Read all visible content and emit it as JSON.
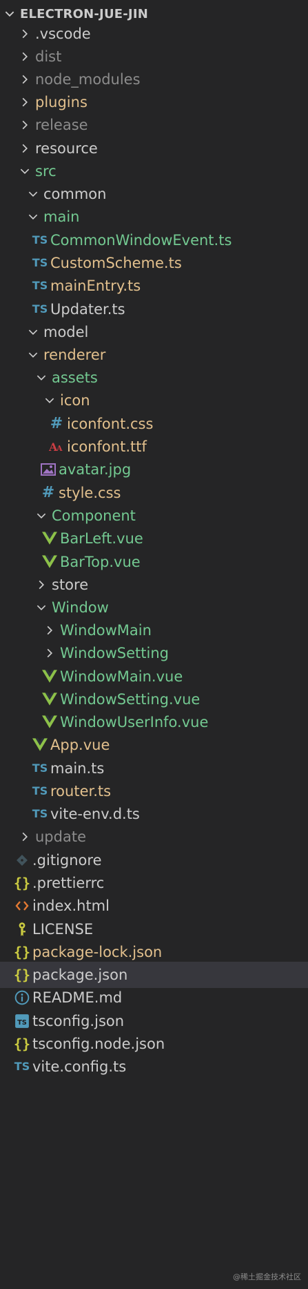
{
  "explorer": {
    "root_label": "ELECTRON-JUE-JIN",
    "items": [
      {
        "label": ".vscode",
        "color": "#cccccc",
        "icon": "chevron-right-icon"
      },
      {
        "label": "dist",
        "color": "#8c8c8c",
        "icon": "chevron-right-icon"
      },
      {
        "label": "node_modules",
        "color": "#8c8c8c",
        "icon": "chevron-right-icon"
      },
      {
        "label": "plugins",
        "color": "#e2c08d",
        "icon": "chevron-right-icon"
      },
      {
        "label": "release",
        "color": "#8c8c8c",
        "icon": "chevron-right-icon"
      },
      {
        "label": "resource",
        "color": "#cccccc",
        "icon": "chevron-right-icon"
      },
      {
        "label": "src",
        "color": "#73c991",
        "icon": "chevron-down-icon"
      },
      {
        "label": "common",
        "color": "#cccccc",
        "icon": "chevron-down-icon"
      },
      {
        "label": "main",
        "color": "#73c991",
        "icon": "chevron-down-icon"
      },
      {
        "label": "CommonWindowEvent.ts",
        "color": "#73c991",
        "icon": "typescript-icon",
        "icon_text": "TS"
      },
      {
        "label": "CustomScheme.ts",
        "color": "#e2c08d",
        "icon": "typescript-icon",
        "icon_text": "TS"
      },
      {
        "label": "mainEntry.ts",
        "color": "#e2c08d",
        "icon": "typescript-icon",
        "icon_text": "TS"
      },
      {
        "label": "Updater.ts",
        "color": "#cccccc",
        "icon": "typescript-icon",
        "icon_text": "TS"
      },
      {
        "label": "model",
        "color": "#cccccc",
        "icon": "chevron-down-icon"
      },
      {
        "label": "renderer",
        "color": "#e2c08d",
        "icon": "chevron-down-icon"
      },
      {
        "label": "assets",
        "color": "#73c991",
        "icon": "chevron-down-icon"
      },
      {
        "label": "icon",
        "color": "#e2c08d",
        "icon": "chevron-down-icon"
      },
      {
        "label": "iconfont.css",
        "color": "#e2c08d",
        "icon": "css-icon",
        "icon_text": "#"
      },
      {
        "label": "iconfont.ttf",
        "color": "#e2c08d",
        "icon": "font-file-icon",
        "icon_text": "A"
      },
      {
        "label": "avatar.jpg",
        "color": "#73c991",
        "icon": "image-icon"
      },
      {
        "label": "style.css",
        "color": "#e2c08d",
        "icon": "css-icon",
        "icon_text": "#"
      },
      {
        "label": "Component",
        "color": "#73c991",
        "icon": "chevron-down-icon"
      },
      {
        "label": "BarLeft.vue",
        "color": "#73c991",
        "icon": "vue-icon"
      },
      {
        "label": "BarTop.vue",
        "color": "#73c991",
        "icon": "vue-icon"
      },
      {
        "label": "store",
        "color": "#cccccc",
        "icon": "chevron-right-icon"
      },
      {
        "label": "Window",
        "color": "#73c991",
        "icon": "chevron-down-icon"
      },
      {
        "label": "WindowMain",
        "color": "#73c991",
        "icon": "chevron-right-icon"
      },
      {
        "label": "WindowSetting",
        "color": "#73c991",
        "icon": "chevron-right-icon"
      },
      {
        "label": "WindowMain.vue",
        "color": "#73c991",
        "icon": "vue-icon"
      },
      {
        "label": "WindowSetting.vue",
        "color": "#73c991",
        "icon": "vue-icon"
      },
      {
        "label": "WindowUserInfo.vue",
        "color": "#73c991",
        "icon": "vue-icon"
      },
      {
        "label": "App.vue",
        "color": "#e2c08d",
        "icon": "vue-icon"
      },
      {
        "label": "main.ts",
        "color": "#cccccc",
        "icon": "typescript-icon",
        "icon_text": "TS"
      },
      {
        "label": "router.ts",
        "color": "#e2c08d",
        "icon": "typescript-icon",
        "icon_text": "TS"
      },
      {
        "label": "vite-env.d.ts",
        "color": "#cccccc",
        "icon": "typescript-icon",
        "icon_text": "TS"
      },
      {
        "label": "update",
        "color": "#8c8c8c",
        "icon": "chevron-right-icon"
      },
      {
        "label": ".gitignore",
        "color": "#cccccc",
        "icon": "git-icon"
      },
      {
        "label": ".prettierrc",
        "color": "#cccccc",
        "icon": "json-braces-icon",
        "icon_text": "{}"
      },
      {
        "label": "index.html",
        "color": "#cccccc",
        "icon": "html-icon"
      },
      {
        "label": "LICENSE",
        "color": "#cccccc",
        "icon": "license-icon"
      },
      {
        "label": "package-lock.json",
        "color": "#e2c08d",
        "icon": "json-braces-icon",
        "icon_text": "{}"
      },
      {
        "label": "package.json",
        "color": "#cccccc",
        "icon": "json-braces-icon",
        "icon_text": "{}",
        "selected": true
      },
      {
        "label": "README.md",
        "color": "#cccccc",
        "icon": "info-icon"
      },
      {
        "label": "tsconfig.json",
        "color": "#cccccc",
        "icon": "tsconfig-icon",
        "icon_text": "TS"
      },
      {
        "label": "tsconfig.node.json",
        "color": "#cccccc",
        "icon": "json-braces-icon",
        "icon_text": "{}"
      },
      {
        "label": "vite.config.ts",
        "color": "#cccccc",
        "icon": "typescript-icon",
        "icon_text": "TS"
      }
    ]
  },
  "watermark": "@稀土掘金技术社区"
}
